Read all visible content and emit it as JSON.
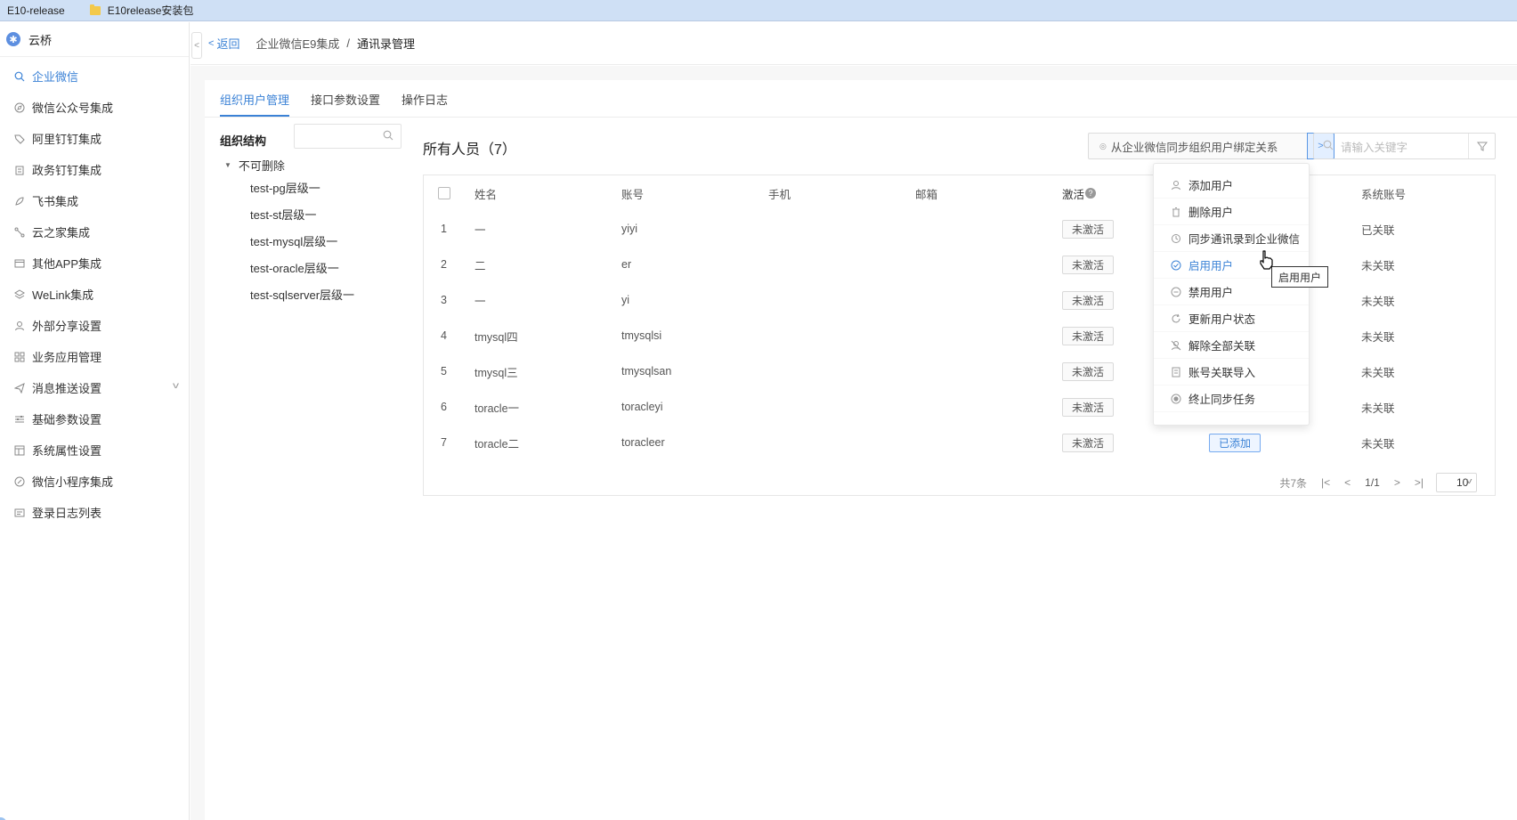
{
  "bookmarks": [
    {
      "label": "E10-release"
    },
    {
      "label": "E10release安装包"
    }
  ],
  "sidebar": {
    "app_logo": "✱",
    "app_name": "云桥",
    "items": [
      {
        "label": "企业微信",
        "icon": "search-icon"
      },
      {
        "label": "微信公众号集成",
        "icon": "compass-icon"
      },
      {
        "label": "阿里钉钉集成",
        "icon": "tag-icon"
      },
      {
        "label": "政务钉钉集成",
        "icon": "building-icon"
      },
      {
        "label": "飞书集成",
        "icon": "feather-icon"
      },
      {
        "label": "云之家集成",
        "icon": "nodes-icon"
      },
      {
        "label": "其他APP集成",
        "icon": "window-icon"
      },
      {
        "label": "WeLink集成",
        "icon": "layers-icon"
      },
      {
        "label": "外部分享设置",
        "icon": "user-icon"
      },
      {
        "label": "业务应用管理",
        "icon": "grid-icon"
      },
      {
        "label": "消息推送设置",
        "icon": "send-icon"
      },
      {
        "label": "基础参数设置",
        "icon": "sliders-icon"
      },
      {
        "label": "系统属性设置",
        "icon": "panel-icon"
      },
      {
        "label": "微信小程序集成",
        "icon": "link-icon"
      },
      {
        "label": "登录日志列表",
        "icon": "log-icon"
      }
    ]
  },
  "breadcrumb": {
    "back": "返回",
    "parent": "企业微信E9集成",
    "sep": "/",
    "current": "通讯录管理"
  },
  "tabs": [
    {
      "label": "组织用户管理"
    },
    {
      "label": "接口参数设置"
    },
    {
      "label": "操作日志"
    }
  ],
  "org": {
    "title": "组织结构",
    "root": "不可删除",
    "children": [
      "test-pg层级一",
      "test-st层级一",
      "test-mysql层级一",
      "test-oracle层级一",
      "test-sqlserver层级一"
    ]
  },
  "list": {
    "title": "所有人员（7）",
    "sync_button": "从企业微信同步组织用户绑定关系",
    "search_placeholder": "请输入关键字"
  },
  "table": {
    "headers": {
      "name": "姓名",
      "account": "账号",
      "phone": "手机",
      "email": "邮箱",
      "active": "激活",
      "system_account": "系统账号"
    },
    "rows": [
      {
        "idx": "1",
        "name": "一",
        "account": "yiyi",
        "active": "未激活",
        "status": "",
        "system": "已关联"
      },
      {
        "idx": "2",
        "name": "二",
        "account": "er",
        "active": "未激活",
        "status": "",
        "system": "未关联"
      },
      {
        "idx": "3",
        "name": "一",
        "account": "yi",
        "active": "未激活",
        "status": "",
        "system": "未关联"
      },
      {
        "idx": "4",
        "name": "tmysql四",
        "account": "tmysqlsi",
        "active": "未激活",
        "status": "",
        "system": "未关联"
      },
      {
        "idx": "5",
        "name": "tmysql三",
        "account": "tmysqlsan",
        "active": "未激活",
        "status": "",
        "system": "未关联"
      },
      {
        "idx": "6",
        "name": "toracle一",
        "account": "toracleyi",
        "active": "未激活",
        "status": "",
        "system": "未关联"
      },
      {
        "idx": "7",
        "name": "toracle二",
        "account": "toracleer",
        "active": "未激活",
        "status": "已添加",
        "system": "未关联"
      }
    ]
  },
  "pagination": {
    "total": "共7条",
    "page": "1/1",
    "page_size": "10"
  },
  "menu": {
    "items": [
      {
        "label": "添加用户",
        "icon": "user-icon"
      },
      {
        "label": "删除用户",
        "icon": "trash-icon"
      },
      {
        "label": "同步通讯录到企业微信",
        "icon": "sync-icon"
      },
      {
        "label": "启用用户",
        "icon": "check-circle-icon"
      },
      {
        "label": "禁用用户",
        "icon": "minus-circle-icon"
      },
      {
        "label": "更新用户状态",
        "icon": "refresh-icon"
      },
      {
        "label": "解除全部关联",
        "icon": "user-off-icon"
      },
      {
        "label": "账号关联导入",
        "icon": "import-icon"
      },
      {
        "label": "终止同步任务",
        "icon": "stop-icon"
      }
    ]
  },
  "tooltip": "启用用户",
  "colors": {
    "accent": "#3b82d6",
    "bookmark_bar": "#cfe0f5"
  }
}
